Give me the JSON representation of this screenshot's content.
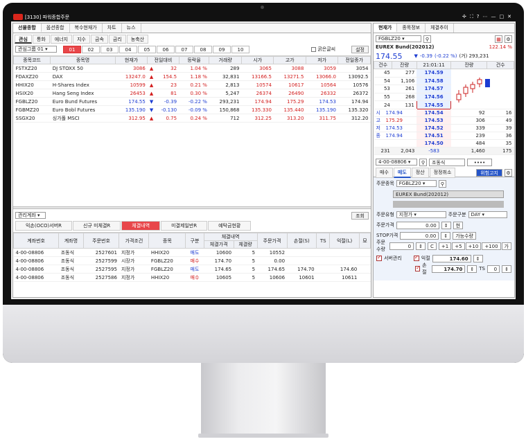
{
  "window": {
    "title": "[3130] 파워종합주문",
    "controls": [
      "✢",
      "⛶",
      "?",
      "⋯",
      "—",
      "□",
      "✕"
    ]
  },
  "left": {
    "tabs": [
      "선물종합",
      "옵션종합",
      "복수현재가",
      "차트",
      "뉴스"
    ],
    "subtabs": [
      "관심",
      "통화",
      "에너지",
      "지수",
      "금속",
      "금리",
      "농축산"
    ],
    "group_label": "관심그룹 01",
    "group_nums": [
      "01",
      "02",
      "03",
      "04",
      "05",
      "06",
      "07",
      "08",
      "09",
      "10"
    ],
    "bold_font_label": "굵은글씨",
    "settings_label": "설정",
    "watch_headers": [
      "종목코드",
      "종목명",
      "현재가",
      "전일대비",
      "등락율",
      "거래량",
      "시가",
      "고가",
      "저가",
      "전일종가"
    ],
    "watch_rows": [
      {
        "code": "FSTXZ20",
        "name": "DJ STOXX 50",
        "price": "3086",
        "dir": "up",
        "chg": "32",
        "pct": "1.04 %",
        "vol": "289",
        "open": "3065",
        "high": "3088",
        "low": "3059",
        "prev": "3054"
      },
      {
        "code": "FDAXZ20",
        "name": "DAX",
        "price": "13247.0",
        "dir": "up",
        "chg": "154.5",
        "pct": "1.18 %",
        "vol": "32,831",
        "open": "13166.5",
        "high": "13271.5",
        "low": "13066.0",
        "prev": "13092.5"
      },
      {
        "code": "HHIX20",
        "name": "H-Shares Index",
        "price": "10599",
        "dir": "up",
        "chg": "23",
        "pct": "0.21 %",
        "vol": "2,813",
        "open": "10574",
        "high": "10617",
        "low": "10564",
        "prev": "10576"
      },
      {
        "code": "HSIX20",
        "name": "Hang Seng Index",
        "price": "26453",
        "dir": "up",
        "chg": "81",
        "pct": "0.30 %",
        "vol": "5,247",
        "open": "26374",
        "high": "26490",
        "low": "26332",
        "prev": "26372"
      },
      {
        "code": "FGBLZ20",
        "name": "Euro Bund Futures",
        "price": "174.55",
        "dir": "dn",
        "chg": "-0.39",
        "pct": "-0.22 %",
        "vol": "293,231",
        "open": "174.94",
        "high": "175.29",
        "low": "174.53",
        "prev": "174.94"
      },
      {
        "code": "FGBMZ20",
        "name": "Euro Bobl Futures",
        "price": "135.190",
        "dir": "dn",
        "chg": "-0.130",
        "pct": "-0.09 %",
        "vol": "150,868",
        "open": "135.330",
        "high": "135.440",
        "low": "135.190",
        "prev": "135.320"
      },
      {
        "code": "SSGX20",
        "name": "싱가폴 MSCI",
        "price": "312.95",
        "dir": "up",
        "chg": "0.75",
        "pct": "0.24 %",
        "vol": "712",
        "open": "312.25",
        "high": "313.20",
        "low": "311.75",
        "prev": "312.20"
      }
    ],
    "acct_label": "관리계좌",
    "query_label": "조회",
    "order_tabs": [
      "익손(OCO)서버R",
      "신규 미체결R",
      "체결내역",
      "미결제일반R",
      "예탁금현황"
    ],
    "fill_headers": [
      "계좌번호",
      "계좌명",
      "주문번호",
      "가격조건",
      "종목",
      "구분",
      "체결내역",
      "주문가격",
      "손절(S)",
      "TS",
      "익절(L)",
      "묘"
    ],
    "fill_sub": [
      "체결가격",
      "체결량"
    ],
    "fill_rows": [
      {
        "acct": "4-00-08806",
        "nm": "조동식",
        "ord": "2527601",
        "cond": "지정가",
        "sym": "HHIX20",
        "side": "매도",
        "fp": "10600",
        "fq": "5",
        "op": "10552",
        "sl": "",
        "ts": "",
        "tp": ""
      },
      {
        "acct": "4-00-08806",
        "nm": "조동식",
        "ord": "2527599",
        "cond": "시장가",
        "sym": "FGBLZ20",
        "side": "매수",
        "fp": "174.70",
        "fq": "5",
        "op": "0.00",
        "sl": "",
        "ts": "",
        "tp": ""
      },
      {
        "acct": "4-00-08806",
        "nm": "조동식",
        "ord": "2527595",
        "cond": "지정가",
        "sym": "FGBLZ20",
        "side": "매도",
        "fp": "174.65",
        "fq": "5",
        "op": "174.65",
        "sl": "174.70",
        "ts": "",
        "tp": "174.60"
      },
      {
        "acct": "4-00-08806",
        "nm": "조동식",
        "ord": "2527586",
        "cond": "지정가",
        "sym": "HHIX20",
        "side": "매수",
        "fp": "10605",
        "fq": "5",
        "op": "10606",
        "sl": "10601",
        "ts": "",
        "tp": "10611"
      }
    ]
  },
  "right": {
    "tabs": [
      "현재가",
      "종목정보",
      "체결추이"
    ],
    "symbol": "FGBLZ20",
    "name": "EUREX Bund(202012)",
    "rate": "122.14 %",
    "price": "174.55",
    "chg": "-0.39",
    "pct": "(-0.22 %)",
    "vol": "(거) 293,231",
    "ob_headers": [
      "건수",
      "잔량",
      "21:01:11",
      "잔량",
      "건수"
    ],
    "asks": [
      [
        "45",
        "277",
        "174.59"
      ],
      [
        "54",
        "1,106",
        "174.58"
      ],
      [
        "53",
        "261",
        "174.57"
      ],
      [
        "55",
        "268",
        "174.56"
      ],
      [
        "24",
        "131",
        "174.55"
      ]
    ],
    "bids": [
      [
        "174.54",
        "92",
        "16"
      ],
      [
        "174.53",
        "306",
        "49"
      ],
      [
        "174.52",
        "339",
        "39"
      ],
      [
        "174.51",
        "239",
        "36"
      ],
      [
        "174.50",
        "484",
        "35"
      ]
    ],
    "ohlc_labels": [
      "시",
      "고",
      "저",
      "종"
    ],
    "ohlc_values": [
      "174.94",
      "175.29",
      "174.53",
      "174.94"
    ],
    "totals": [
      "231",
      "2,043",
      "-583",
      "1,460",
      "175"
    ],
    "acct": "4-00-08806",
    "acct_name": "조동식",
    "pw": "••••",
    "order_tabs": [
      "매수",
      "매도",
      "정산",
      "정정취소"
    ],
    "risk_label": "위험고지",
    "form": {
      "symbol_label": "주문종목",
      "symbol": "FGBLZ20",
      "name": "EUREX Bund(202012)",
      "type_label": "주문유형",
      "type": "지정가",
      "cond_label": "주문구분",
      "cond": "DAY",
      "price_label": "주문가격",
      "price": "0.00",
      "cur_label": "현",
      "stop_label": "STOP가격",
      "stop": "0.00",
      "avail_label": "가능수량",
      "qty_label": "주문수량",
      "qty": "0",
      "c_label": "C",
      "qty_btns": [
        "+1",
        "+5",
        "+10",
        "+100",
        "가"
      ],
      "server_label": "서버관리",
      "tp_label": "익절",
      "tp": "174.60",
      "sl_label": "손절",
      "sl": "174.70",
      "ts_label": "TS",
      "ts": "0"
    }
  },
  "colors": {
    "up": "#d21c1c",
    "down": "#1c3cd2",
    "accent": "#e8464a"
  }
}
